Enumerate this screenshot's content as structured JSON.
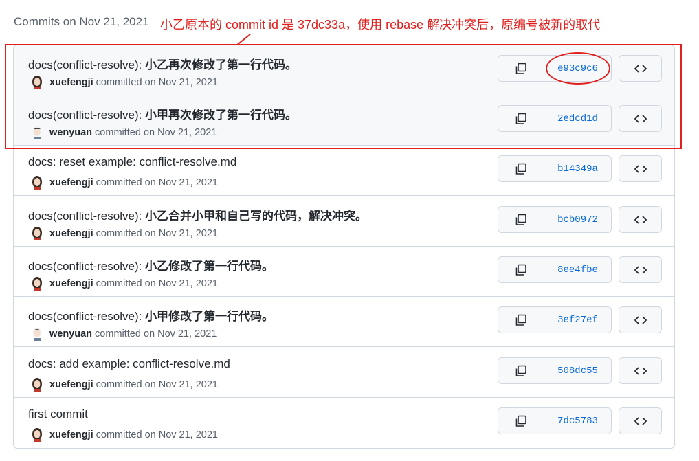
{
  "header": {
    "title": "Commits on Nov 21, 2021"
  },
  "annotation": {
    "text": "小乙原本的 commit id 是 37dc33a，使用 rebase 解决冲突后，原编号被新的取代",
    "color": "#e0201e"
  },
  "commits": [
    {
      "prefix": "docs(conflict-resolve): ",
      "title": "小乙再次修改了第一行代码。",
      "author": "xuefengji",
      "date": "committed on Nov 21, 2021",
      "sha": "e93c9c6"
    },
    {
      "prefix": "docs(conflict-resolve): ",
      "title": "小甲再次修改了第一行代码。",
      "author": "wenyuan",
      "date": "committed on Nov 21, 2021",
      "sha": "2edcd1d"
    },
    {
      "prefix": "docs: reset example: conflict-resolve.md",
      "title": "",
      "author": "xuefengji",
      "date": "committed on Nov 21, 2021",
      "sha": "b14349a"
    },
    {
      "prefix": "docs(conflict-resolve): ",
      "title": "小乙合并小甲和自己写的代码，解决冲突。",
      "author": "xuefengji",
      "date": "committed on Nov 21, 2021",
      "sha": "bcb0972"
    },
    {
      "prefix": "docs(conflict-resolve): ",
      "title": "小乙修改了第一行代码。",
      "author": "xuefengji",
      "date": "committed on Nov 21, 2021",
      "sha": "8ee4fbe"
    },
    {
      "prefix": "docs(conflict-resolve): ",
      "title": "小甲修改了第一行代码。",
      "author": "wenyuan",
      "date": "committed on Nov 21, 2021",
      "sha": "3ef27ef"
    },
    {
      "prefix": "docs: add example: conflict-resolve.md",
      "title": "",
      "author": "xuefengji",
      "date": "committed on Nov 21, 2021",
      "sha": "508dc55"
    },
    {
      "prefix": "first commit",
      "title": "",
      "author": "xuefengji",
      "date": "committed on Nov 21, 2021",
      "sha": "7dc5783"
    }
  ],
  "icons": {
    "copy": "copy-icon",
    "browse": "code-icon"
  },
  "colors": {
    "sha_link": "#0969da",
    "highlight": "#e0201e"
  }
}
